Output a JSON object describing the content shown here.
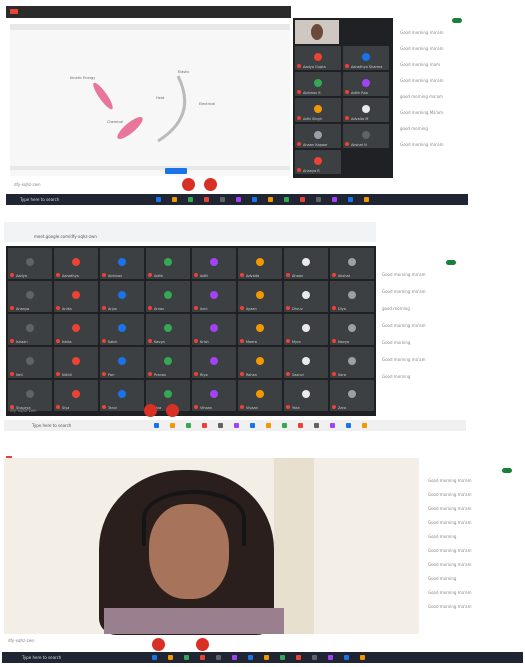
{
  "panel1": {
    "slide": {
      "zoom_label": "Let's Fill",
      "labels": [
        "Kinetic Energy",
        "Elastic",
        "Heat",
        "Electrical",
        "Chemical"
      ]
    },
    "participants": [
      "Ms Sujata Chaturvedi",
      "Aadya Gupta",
      "Aaradhya Sharma",
      "Abhinav K",
      "Adith Rao",
      "Aditi Singh",
      "Advaita M",
      "Ahaan Kapoor",
      "Akshat N",
      "Ananya R"
    ],
    "chat_messages": [
      "Good morning ma'am",
      "Good morning ma'am",
      "Good morning mam",
      "Good morning ma'am",
      "good morning ma'am",
      "Good morning Ma'am",
      "good morning",
      "Good morning ma'am"
    ],
    "meeting_code": "dfy-xqhz-zwn",
    "search_placeholder": "Type here to search"
  },
  "panel2": {
    "url": "meet.google.com/dfy-xqhz-zwn",
    "participants": [
      "Aadya",
      "Aaradhya",
      "Abhinav",
      "Adith",
      "Aditi",
      "Advaita",
      "Ahaan",
      "Akshat",
      "Ananya",
      "Anika",
      "Arjun",
      "Arnav",
      "Avni",
      "Ayaan",
      "Dhruv",
      "Diya",
      "Ishaan",
      "Ishita",
      "Kabir",
      "Kavya",
      "Krish",
      "Meera",
      "Myra",
      "Navya",
      "Neil",
      "Nikhil",
      "Pari",
      "Pranav",
      "Riya",
      "Rohan",
      "Saanvi",
      "Sara",
      "Shaurya",
      "Siya",
      "Tanvi",
      "Tara",
      "Vihaan",
      "Vivaan",
      "Yash",
      "Zara"
    ],
    "chat_messages": [
      "Good morning ma'am",
      "Good morning ma'am",
      "good morning",
      "Good morning ma'am",
      "Good morning",
      "Good morning ma'am",
      "Good morning"
    ],
    "meeting_code": "dfy-xqhz-zwn",
    "search_placeholder": "Type here to search"
  },
  "panel3": {
    "chat_messages": [
      "Good morning ma'am",
      "Good morning ma'am",
      "Good morning ma'am",
      "Good morning ma'am",
      "Good morning",
      "Good morning ma'am",
      "Good morning ma'am",
      "Good morning",
      "Good morning ma'am",
      "Good morning ma'am"
    ],
    "meeting_code": "dfy-xqhz-zwn",
    "search_placeholder": "Type here to search"
  },
  "colors": {
    "accent": "#ea4335",
    "meet_dark": "#202124",
    "tile": "#3c4043",
    "pink": "#e8769b",
    "taskbar": "#1f2532"
  }
}
